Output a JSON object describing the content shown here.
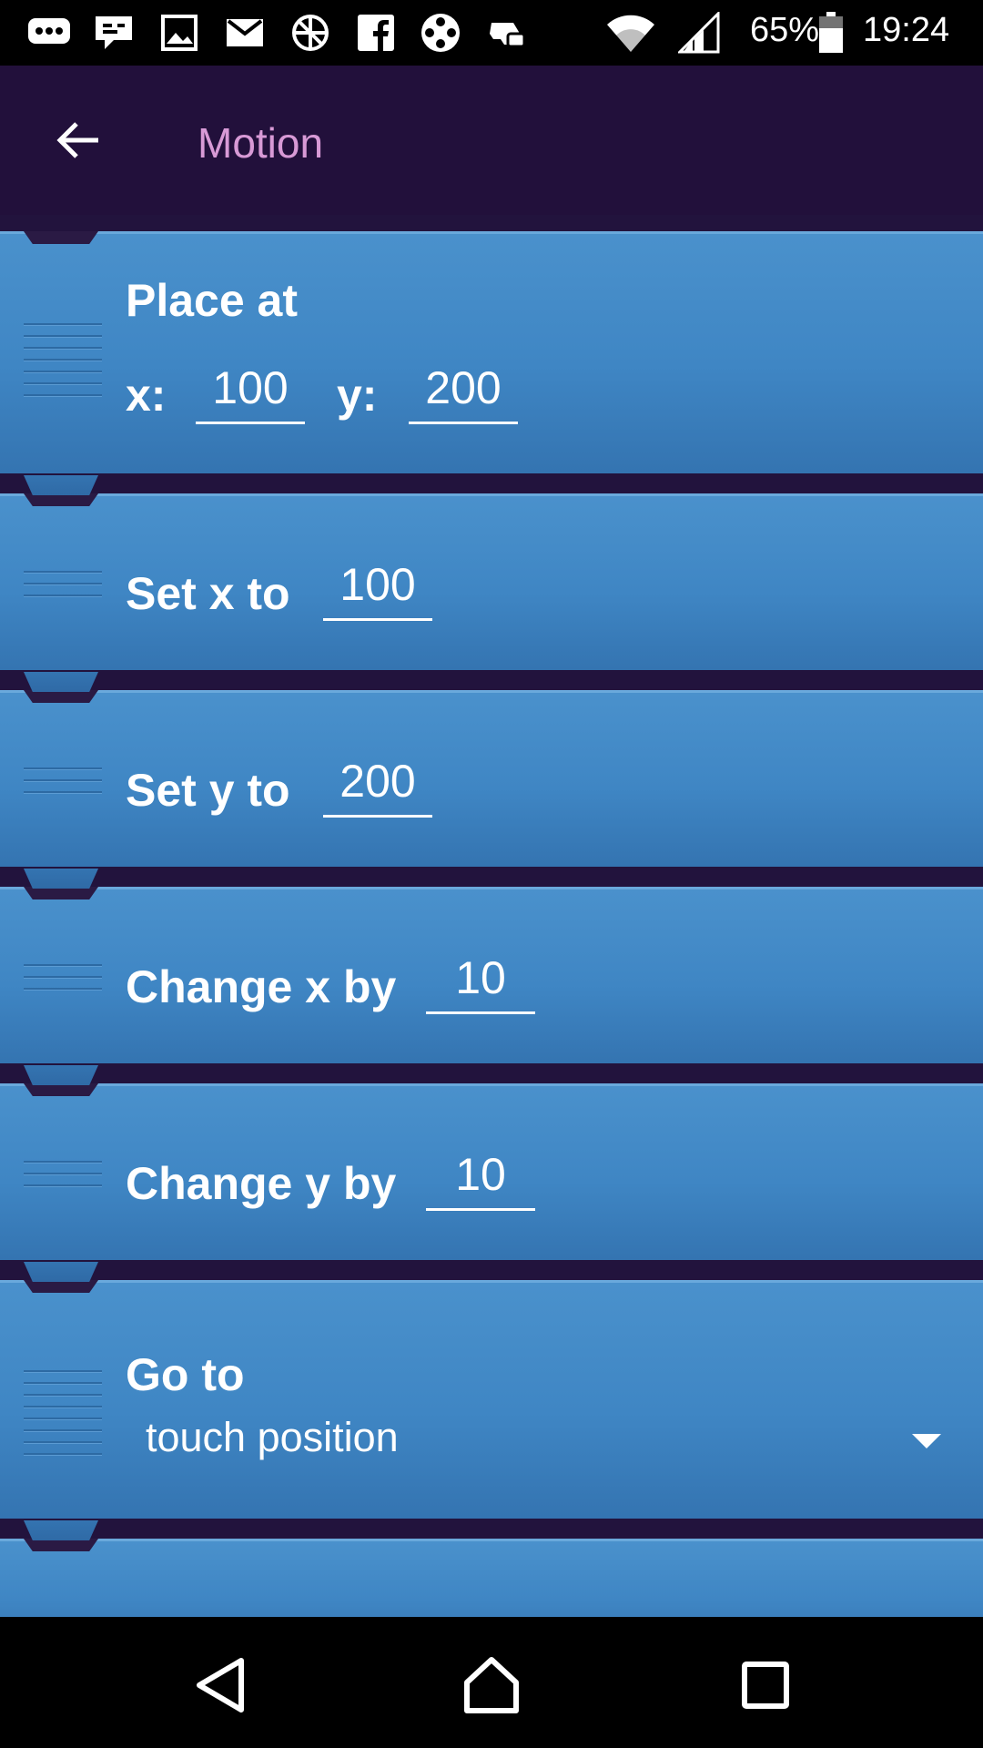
{
  "status_bar": {
    "icons": [
      "message-icon",
      "chat-icon",
      "image-icon",
      "mail-icon",
      "vpn-icon",
      "facebook-icon",
      "film-icon",
      "gamepad-icon"
    ],
    "battery": "65%",
    "time": "19:24"
  },
  "app_bar": {
    "title": "Motion",
    "title_color": "#d89ad6",
    "background": "#22103b"
  },
  "bricks": {
    "place_at": {
      "label": "Place at",
      "x_label": "x:",
      "x_value": "100",
      "y_label": "y:",
      "y_value": "200"
    },
    "set_x": {
      "label": "Set x to",
      "value": "100"
    },
    "set_y": {
      "label": "Set y to",
      "value": "200"
    },
    "change_x": {
      "label": "Change x by",
      "value": "10"
    },
    "change_y": {
      "label": "Change y by",
      "value": "10"
    },
    "go_to": {
      "label": "Go to",
      "selected": "touch position"
    }
  },
  "colors": {
    "brick_blue": "#4a91cc",
    "background": "#22133d"
  },
  "nav_bar": {
    "buttons": [
      "back-triangle-icon",
      "home-icon",
      "recents-icon"
    ]
  }
}
